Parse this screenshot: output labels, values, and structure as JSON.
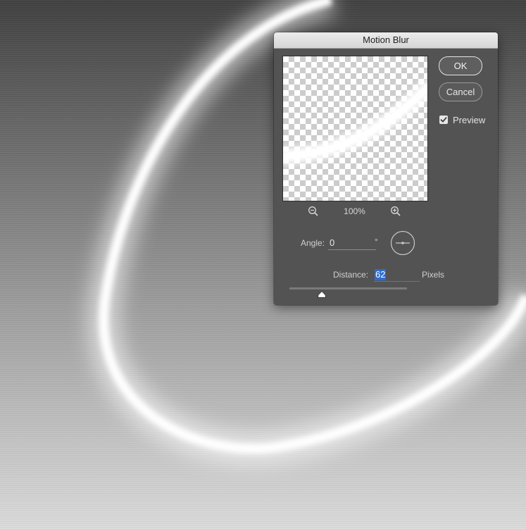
{
  "dialog": {
    "title": "Motion Blur",
    "ok_label": "OK",
    "cancel_label": "Cancel",
    "preview_label": "Preview",
    "preview_checked": true,
    "zoom_level": "100%",
    "angle_label": "Angle:",
    "angle_value": "0",
    "degree_symbol": "°",
    "distance_label": "Distance:",
    "distance_value": "62",
    "distance_units": "Pixels",
    "distance_slider_fraction": 0.28
  },
  "icons": {
    "zoom_out": "zoom-out-icon",
    "zoom_in": "zoom-in-icon",
    "checkmark": "checkmark-icon",
    "angle_dial": "angle-dial-icon"
  },
  "colors": {
    "dialog_bg": "#535353",
    "selection": "#2f6bd0"
  }
}
